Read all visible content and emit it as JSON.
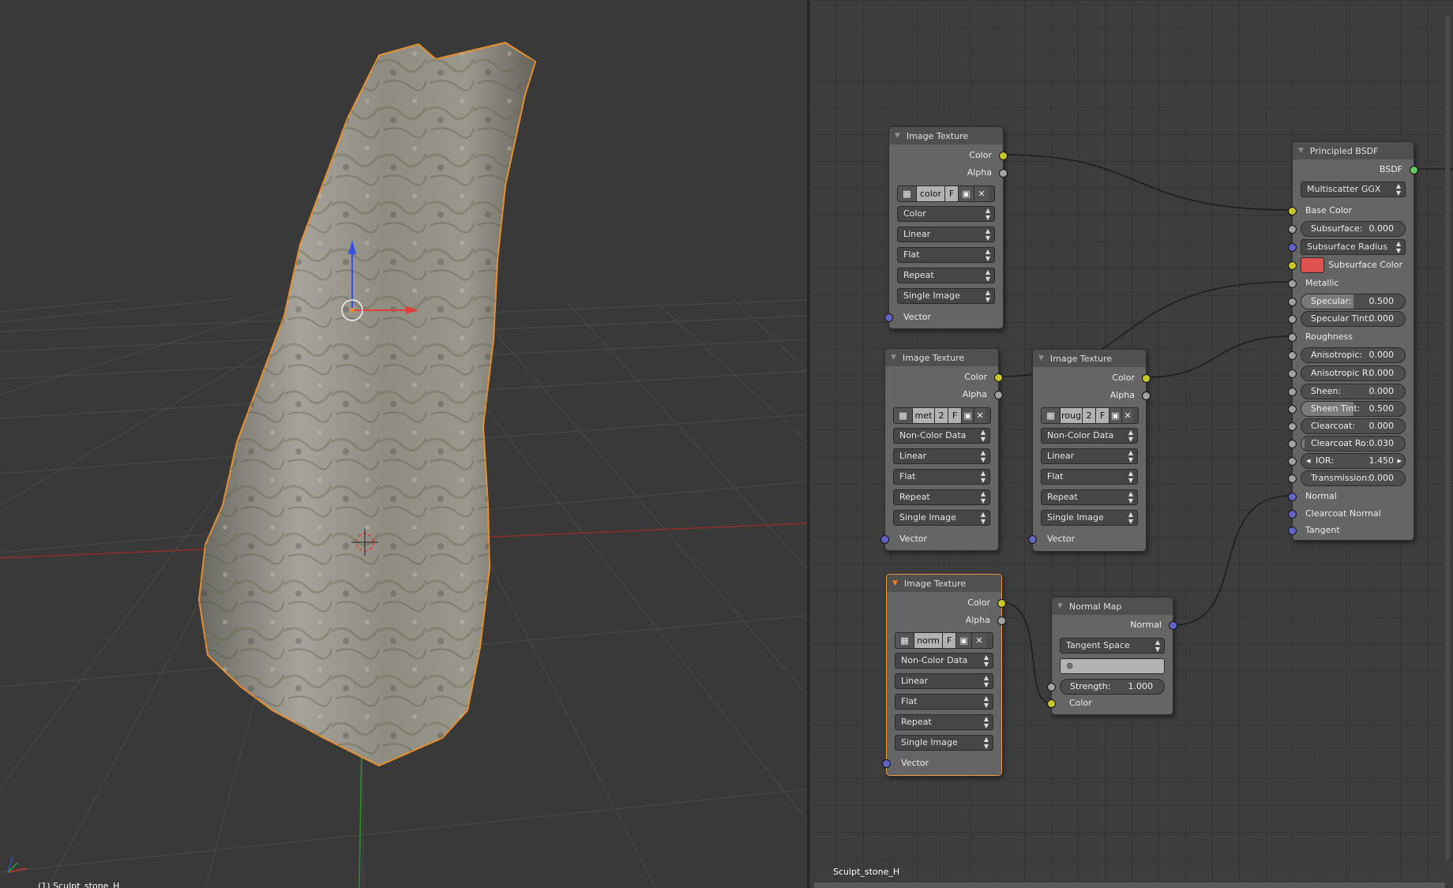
{
  "viewport": {
    "object_label": "(1) Sculpt_stone_H",
    "axes_icon": "axes-gizmo-icon"
  },
  "node_editor": {
    "material_label": "Sculpt_stone_H",
    "nodes": {
      "tex_color": {
        "title": "Image Texture",
        "out_color": "Color",
        "out_alpha": "Alpha",
        "image_name": "color",
        "image_users": "",
        "fake_user": "F",
        "color_space": "Color",
        "interpolation": "Linear",
        "projection": "Flat",
        "extension": "Repeat",
        "source": "Single Image",
        "in_vector": "Vector"
      },
      "tex_metal": {
        "title": "Image Texture",
        "out_color": "Color",
        "out_alpha": "Alpha",
        "image_name": "met",
        "image_users": "2",
        "fake_user": "F",
        "color_space": "Non-Color Data",
        "interpolation": "Linear",
        "projection": "Flat",
        "extension": "Repeat",
        "source": "Single Image",
        "in_vector": "Vector"
      },
      "tex_rough": {
        "title": "Image Texture",
        "out_color": "Color",
        "out_alpha": "Alpha",
        "image_name": "roug",
        "image_users": "2",
        "fake_user": "F",
        "color_space": "Non-Color Data",
        "interpolation": "Linear",
        "projection": "Flat",
        "extension": "Repeat",
        "source": "Single Image",
        "in_vector": "Vector"
      },
      "tex_normal": {
        "title": "Image Texture",
        "out_color": "Color",
        "out_alpha": "Alpha",
        "image_name": "norm",
        "image_users": "",
        "fake_user": "F",
        "color_space": "Non-Color Data",
        "interpolation": "Linear",
        "projection": "Flat",
        "extension": "Repeat",
        "source": "Single Image",
        "in_vector": "Vector"
      },
      "normal_map": {
        "title": "Normal Map",
        "out_normal": "Normal",
        "space": "Tangent Space",
        "strength_label": "Strength:",
        "strength_value": "1.000",
        "in_color": "Color"
      },
      "bsdf": {
        "title": "Principled BSDF",
        "out_bsdf": "BSDF",
        "distribution": "Multiscatter GGX",
        "base_color": "Base Color",
        "subsurface_label": "Subsurface:",
        "subsurface_value": "0.000",
        "subsurface_method": "Subsurface Radius",
        "subsurface_color": "Subsurface Color",
        "subsurface_color_hex": "#e05252",
        "metallic": "Metallic",
        "specular_label": "Specular:",
        "specular_value": "0.500",
        "specular_tint_label": "Specular Tint:",
        "specular_tint_value": "0.000",
        "roughness": "Roughness",
        "anisotropic_label": "Anisotropic:",
        "anisotropic_value": "0.000",
        "anisotropic_r_label": "Anisotropic R:",
        "anisotropic_r_value": "0.000",
        "sheen_label": "Sheen:",
        "sheen_value": "0.000",
        "sheen_tint_label": "Sheen Tint:",
        "sheen_tint_value": "0.500",
        "clearcoat_label": "Clearcoat:",
        "clearcoat_value": "0.000",
        "clearcoat_ro_label": "Clearcoat Ro:",
        "clearcoat_ro_value": "0.030",
        "ior_label": "IOR:",
        "ior_value": "1.450",
        "transmission_label": "Transmission:",
        "transmission_value": "0.000",
        "normal": "Normal",
        "clearcoat_normal": "Clearcoat Normal",
        "tangent": "Tangent"
      }
    }
  },
  "colors": {
    "selection_outline": "#ee9b3a",
    "socket_color": "#c7c729",
    "socket_float": "#a1a1a1",
    "socket_vector": "#6363c7",
    "socket_shader": "#63c763"
  }
}
